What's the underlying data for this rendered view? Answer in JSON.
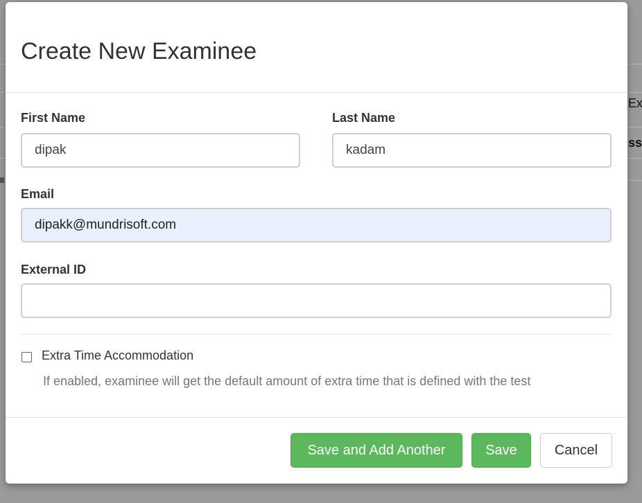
{
  "background": {
    "col_header_fragment": "Exi",
    "row_fragment": "ssi"
  },
  "modal": {
    "title": "Create New Examinee",
    "fields": {
      "first_name": {
        "label": "First Name",
        "value": "dipak"
      },
      "last_name": {
        "label": "Last Name",
        "value": "kadam"
      },
      "email": {
        "label": "Email",
        "value": "dipakk@mundrisoft.com"
      },
      "external_id": {
        "label": "External ID",
        "value": ""
      }
    },
    "extra_time": {
      "label": "Extra Time Accommodation",
      "checked": false,
      "help": "If enabled, examinee will get the default amount of extra time that is defined with the test"
    },
    "buttons": {
      "save_and_add": "Save and Add Another",
      "save": "Save",
      "cancel": "Cancel"
    }
  },
  "colors": {
    "success": "#5cb85c",
    "autofill_bg": "#e8f0fe",
    "overlay": "#8a8a8a"
  }
}
